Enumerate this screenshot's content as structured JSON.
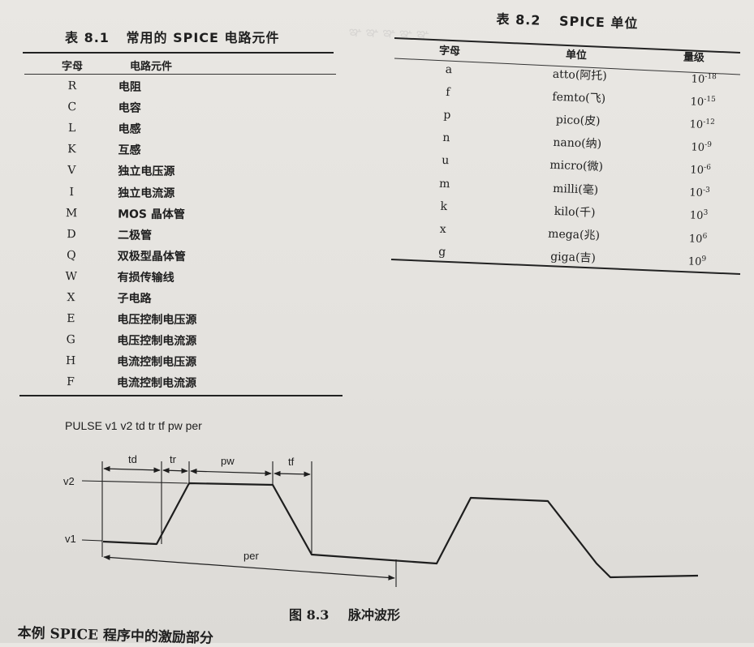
{
  "table1": {
    "caption_num": "表 8.1",
    "caption_title": "常用的 SPICE 电路元件",
    "header": {
      "letter": "字母",
      "name": "电路元件"
    },
    "rows": [
      {
        "letter": "R",
        "name": "电阻"
      },
      {
        "letter": "C",
        "name": "电容"
      },
      {
        "letter": "L",
        "name": "电感"
      },
      {
        "letter": "K",
        "name": "互感"
      },
      {
        "letter": "V",
        "name": "独立电压源"
      },
      {
        "letter": "I",
        "name": "独立电流源"
      },
      {
        "letter": "M",
        "name": "MOS 晶体管"
      },
      {
        "letter": "D",
        "name": "二极管"
      },
      {
        "letter": "Q",
        "name": "双极型晶体管"
      },
      {
        "letter": "W",
        "name": "有损传输线"
      },
      {
        "letter": "X",
        "name": "子电路"
      },
      {
        "letter": "E",
        "name": "电压控制电压源"
      },
      {
        "letter": "G",
        "name": "电压控制电流源"
      },
      {
        "letter": "H",
        "name": "电流控制电压源"
      },
      {
        "letter": "F",
        "name": "电流控制电流源"
      }
    ]
  },
  "table2": {
    "caption_num": "表 8.2",
    "caption_title": "SPICE 单位",
    "header": {
      "letter": "字母",
      "unit": "单位",
      "magnitude": "量级"
    },
    "rows": [
      {
        "letter": "a",
        "unit": "atto(阿托)",
        "base": "10",
        "exp": "-18"
      },
      {
        "letter": "f",
        "unit": "femto(飞)",
        "base": "10",
        "exp": "-15"
      },
      {
        "letter": "p",
        "unit": "pico(皮)",
        "base": "10",
        "exp": "-12"
      },
      {
        "letter": "n",
        "unit": "nano(纳)",
        "base": "10",
        "exp": "-9"
      },
      {
        "letter": "u",
        "unit": "micro(微)",
        "base": "10",
        "exp": "-6"
      },
      {
        "letter": "m",
        "unit": "milli(毫)",
        "base": "10",
        "exp": "-3"
      },
      {
        "letter": "k",
        "unit": "kilo(千)",
        "base": "10",
        "exp": "3"
      },
      {
        "letter": "x",
        "unit": "mega(兆)",
        "base": "10",
        "exp": "6"
      },
      {
        "letter": "g",
        "unit": "giga(吉)",
        "base": "10",
        "exp": "9"
      }
    ]
  },
  "figure": {
    "pulse_syntax": "PULSE v1 v2 td tr tf pw per",
    "labels": {
      "td": "td",
      "tr": "tr",
      "pw": "pw",
      "tf": "tf",
      "per": "per",
      "v1": "v1",
      "v2": "v2"
    },
    "caption_num": "图 8.3",
    "caption_title": "脉冲波形"
  },
  "body_text": "本例 SPICE 程序中的激励部分"
}
